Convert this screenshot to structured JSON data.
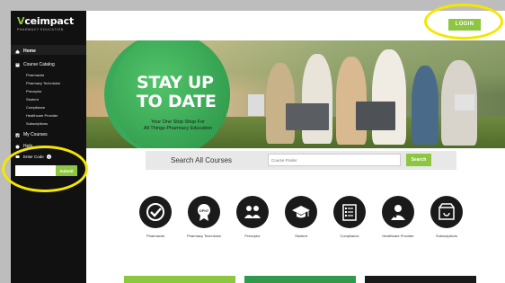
{
  "app": {
    "logo_main": "ceimpact",
    "logo_v": "V",
    "logo_sub": "PHARMACY EDUCATION",
    "login_label": "LOGIN"
  },
  "sidebar": {
    "home": "Home",
    "course_catalog": "Course Catalog",
    "sub_items": [
      "Pharmacist",
      "Pharmacy Technician",
      "Preceptor",
      "Student",
      "Compliance",
      "Healthcare Provider",
      "Subscriptions"
    ],
    "my_courses": "My Courses",
    "help": "Help",
    "enter_code_label": "Enter Code",
    "code_placeholder": "",
    "submit_label": "Submit"
  },
  "hero": {
    "title_line1": "STAY UP",
    "title_line2": "TO DATE",
    "subtitle_line1": "Your One Stop Shop For",
    "subtitle_line2": "All Things Pharmacy Education"
  },
  "search": {
    "label": "Search All Courses",
    "placeholder": "Course Finder",
    "button": "Search"
  },
  "categories": [
    {
      "label": "Pharmacist",
      "icon": "check-icon"
    },
    {
      "label": "Pharmacy Technician",
      "icon": "cpht-badge-icon"
    },
    {
      "label": "Preceptor",
      "icon": "people-icon"
    },
    {
      "label": "Student",
      "icon": "graduation-cap-icon"
    },
    {
      "label": "Compliance",
      "icon": "checklist-icon"
    },
    {
      "label": "Healthcare Provider",
      "icon": "doctor-icon"
    },
    {
      "label": "Subscriptions",
      "icon": "subscription-box-icon"
    }
  ],
  "colors": {
    "accent_green": "#8dc63f",
    "sidebar_bg": "#111111",
    "hero_green": "#3aaa5a",
    "annotation_yellow": "#f5e600"
  }
}
